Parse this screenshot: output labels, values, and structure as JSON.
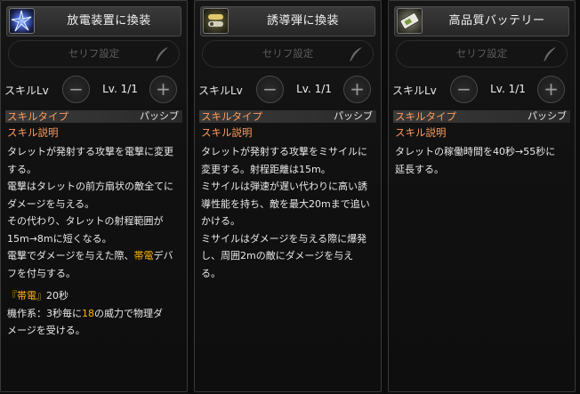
{
  "panels": [
    {
      "title": "放電装置に換装",
      "icon": "electric-discharge-icon",
      "serif_placeholder": "セリフ設定",
      "skill_lv_label": "スキルLv",
      "minus": "−",
      "plus": "+",
      "level_text": "Lv. 1/1",
      "skill_type_label": "スキルタイプ",
      "skill_type_value": "パッシブ",
      "skill_desc_label": "スキル説明",
      "lines": {
        "l1": "タレットが発射する攻撃を電撃に変更",
        "l2": "する。",
        "l3": "電撃はタレットの前方扇状の敵全てに",
        "l4": "ダメージを与える。",
        "l5": "その代わり、タレットの射程範囲が",
        "l6": "15m→8mに短くなる。",
        "l7a": "電撃でダメージを与えた際、",
        "l7b": "帯電",
        "l7c": "デバ",
        "l8": "フを付与する。",
        "l9a": "『帯電』",
        "l9b": "20秒",
        "l10a": "機作系：3秒毎に",
        "l10b": "18",
        "l10c": "の威力で物理ダ",
        "l11": "メージを受ける。"
      }
    },
    {
      "title": "誘導弾に換装",
      "icon": "homing-missile-icon",
      "serif_placeholder": "セリフ設定",
      "skill_lv_label": "スキルLv",
      "minus": "−",
      "plus": "+",
      "level_text": "Lv. 1/1",
      "skill_type_label": "スキルタイプ",
      "skill_type_value": "パッシブ",
      "skill_desc_label": "スキル説明",
      "lines": {
        "l1": "タレットが発射する攻撃をミサイルに",
        "l2": "変更する。射程距離は15m。",
        "l3": "ミサイルは弾速が遅い代わりに高い誘",
        "l4": "導性能を持ち、敵を最大20mまで追い",
        "l5": "かける。",
        "l6": "ミサイルはダメージを与える際に爆発",
        "l7": "し、周囲2mの敵にダメージを与え",
        "l8": "る。"
      }
    },
    {
      "title": "高品質バッテリー",
      "icon": "battery-icon",
      "serif_placeholder": "セリフ設定",
      "skill_lv_label": "スキルLv",
      "minus": "−",
      "plus": "+",
      "level_text": "Lv. 1/1",
      "skill_type_label": "スキルタイプ",
      "skill_type_value": "パッシブ",
      "skill_desc_label": "スキル説明",
      "lines": {
        "l1": "タレットの稼働時間を40秒→55秒に",
        "l2": "延長する。"
      }
    }
  ]
}
